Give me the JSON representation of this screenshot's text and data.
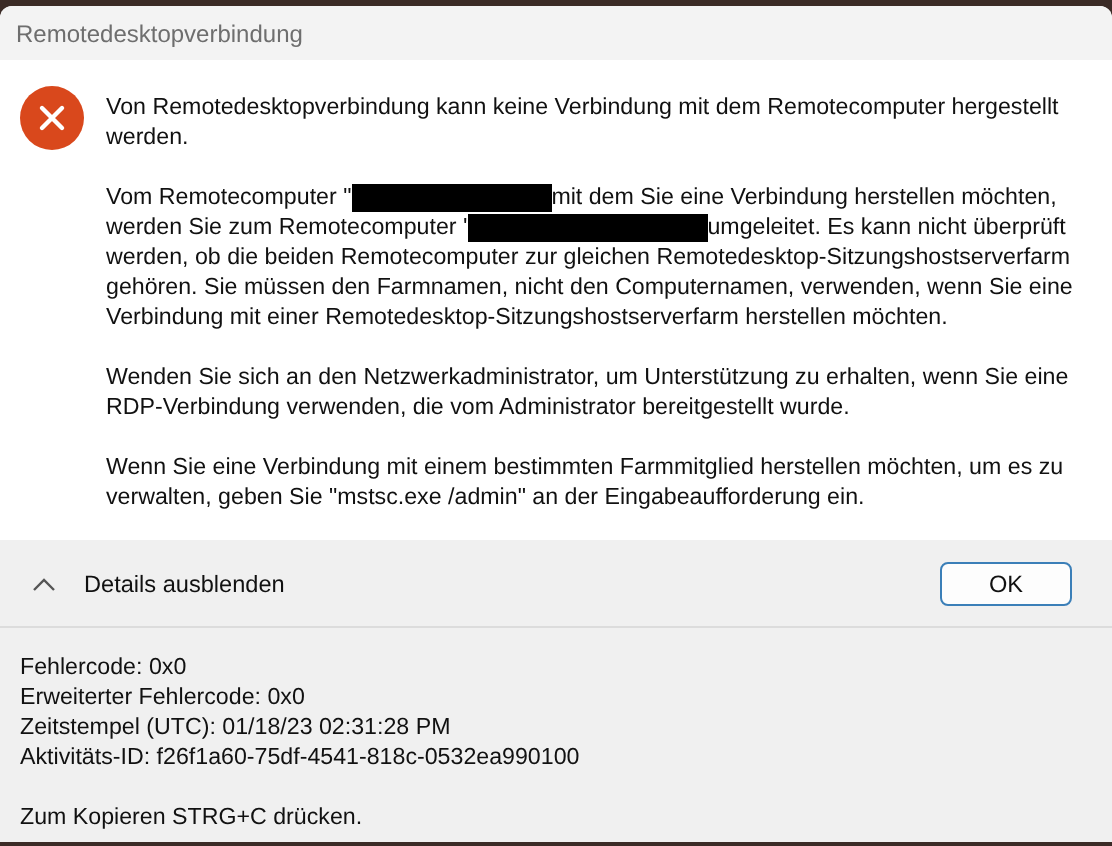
{
  "window": {
    "title": "Remotedesktopverbindung"
  },
  "message": {
    "paragraphs": [
      {
        "lines": [
          {
            "kind": "text",
            "text": "Von Remotedesktopverbindung kann keine Verbindung mit dem Remotecomputer hergestellt werden."
          }
        ]
      },
      {
        "lines": [
          {
            "kind": "redacted",
            "before": "Vom Remotecomputer \"",
            "after": " mit dem Sie eine Verbindung herstellen möchten,"
          },
          {
            "kind": "redacted",
            "before": "werden Sie zum Remotecomputer '",
            "after": "umgeleitet. Es kann nicht überprüft"
          },
          {
            "kind": "text",
            "text": "werden, ob die beiden Remotecomputer zur gleichen Remotedesktop-Sitzungshostserverfarm gehören. Sie müssen den Farmnamen, nicht den Computernamen, verwenden, wenn Sie eine Verbindung mit einer Remotedesktop-Sitzungshostserverfarm herstellen möchten."
          }
        ]
      },
      {
        "lines": [
          {
            "kind": "text",
            "text": "Wenden Sie sich an den Netzwerkadministrator, um Unterstützung zu erhalten, wenn Sie eine RDP-Verbindung verwenden, die vom Administrator bereitgestellt wurde."
          }
        ]
      },
      {
        "lines": [
          {
            "kind": "text",
            "text": "Wenn Sie eine Verbindung mit einem bestimmten Farmmitglied herstellen möchten, um es zu verwalten, geben Sie \"mstsc.exe /admin\" an der Eingabeaufforderung ein."
          }
        ]
      }
    ]
  },
  "details_toggle": {
    "label": "Details ausblenden",
    "expanded": true
  },
  "buttons": [
    "OK"
  ],
  "details": {
    "lines": [
      "Fehlercode: 0x0",
      "Erweiterter Fehlercode: 0x0",
      "Zeitstempel (UTC): 01/18/23 02:31:28 PM",
      "Aktivitäts-ID: f26f1a60-75df-4541-818c-0532ea990100"
    ],
    "hint": "Zum Kopieren STRG+C drücken."
  }
}
